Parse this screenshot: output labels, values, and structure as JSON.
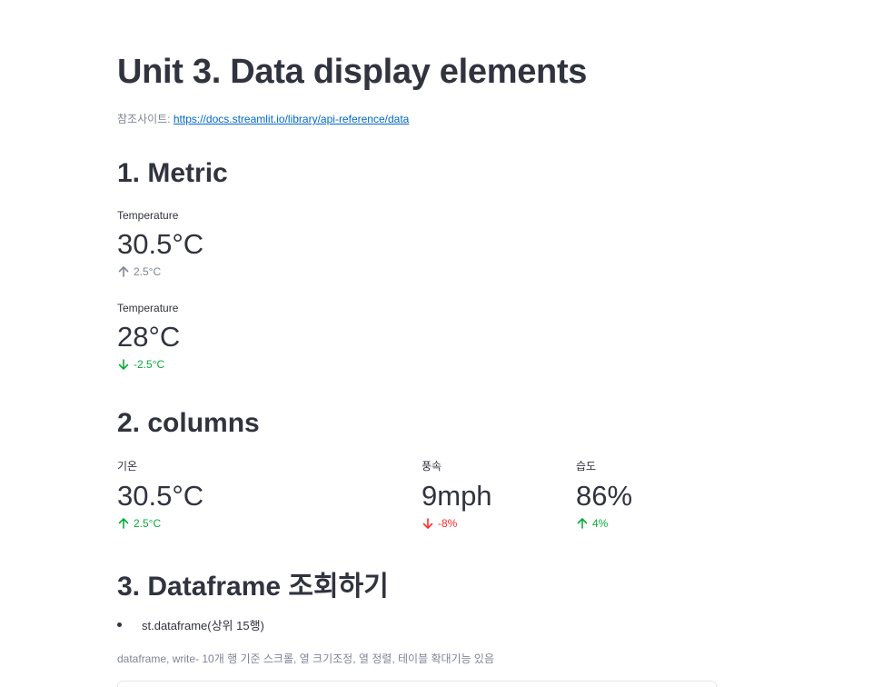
{
  "page": {
    "title": "Unit 3. Data display elements",
    "ref_label": "참조사이트: ",
    "ref_link": "https://docs.streamlit.io/library/api-reference/data"
  },
  "sections": {
    "metric": "1. Metric",
    "columns": "2. columns",
    "dataframe": "3. Dataframe 조회하기"
  },
  "metrics": [
    {
      "label": "Temperature",
      "value": "30.5°C",
      "delta": "2.5°C",
      "direction": "up",
      "color": "#808495"
    },
    {
      "label": "Temperature",
      "value": "28°C",
      "delta": "-2.5°C",
      "direction": "down",
      "color": "#09ab3b"
    }
  ],
  "columns": [
    {
      "label": "기온",
      "value": "30.5°C",
      "delta": "2.5°C",
      "direction": "up",
      "color": "#09ab3b"
    },
    {
      "label": "풍속",
      "value": "9mph",
      "delta": "-8%",
      "direction": "down",
      "color": "#ff2b2b"
    },
    {
      "label": "습도",
      "value": "86%",
      "delta": "4%",
      "direction": "up",
      "color": "#09ab3b"
    }
  ],
  "dataframe": {
    "bullet": "st.dataframe(상위 15행)",
    "caption": "dataframe, write- 10개 행 기준 스크롤, 열 크기조정, 열 정렬, 테이블 확대기능 있음"
  }
}
